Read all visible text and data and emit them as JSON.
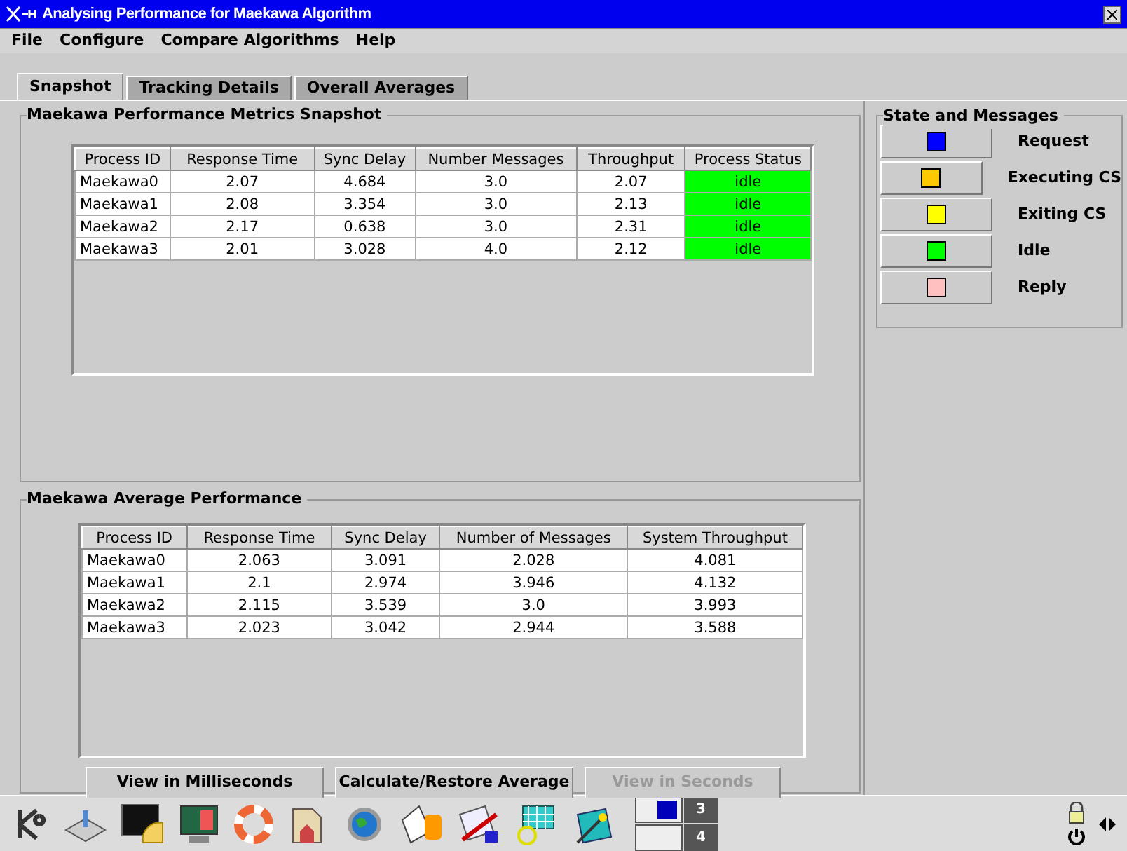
{
  "window": {
    "title": "Analysing Performance for Maekawa Algorithm"
  },
  "menu": [
    "File",
    "Configure",
    "Compare Algorithms",
    "Help"
  ],
  "tabs": [
    {
      "label": "Snapshot",
      "selected": true
    },
    {
      "label": "Tracking Details",
      "selected": false
    },
    {
      "label": "Overall Averages",
      "selected": false
    }
  ],
  "snapshot": {
    "title": "Maekawa Performance Metrics Snapshot",
    "columns": [
      "Process ID",
      "Response Time",
      "Sync Delay",
      "Number Messages",
      "Throughput",
      "Process Status"
    ],
    "rows": [
      {
        "cells": [
          "Maekawa0",
          "2.07",
          "4.684",
          "3.0",
          "2.07"
        ],
        "status": "idle",
        "color": "#00ff00"
      },
      {
        "cells": [
          "Maekawa1",
          "2.08",
          "3.354",
          "3.0",
          "2.13"
        ],
        "status": "idle",
        "color": "#00ff00"
      },
      {
        "cells": [
          "Maekawa2",
          "2.17",
          "0.638",
          "3.0",
          "2.31"
        ],
        "status": "idle",
        "color": "#00ff00"
      },
      {
        "cells": [
          "Maekawa3",
          "2.01",
          "3.028",
          "4.0",
          "2.12"
        ],
        "status": "idle",
        "color": "#00ff00"
      }
    ]
  },
  "averages": {
    "title": "Maekawa Average Performance",
    "columns": [
      "Process ID",
      "Response Time",
      "Sync Delay",
      "Number of Messages",
      "System Throughput"
    ],
    "rows": [
      [
        "Maekawa0",
        "2.063",
        "3.091",
        "2.028",
        "4.081"
      ],
      [
        "Maekawa1",
        "2.1",
        "2.974",
        "3.946",
        "4.132"
      ],
      [
        "Maekawa2",
        "2.115",
        "3.539",
        "3.0",
        "3.993"
      ],
      [
        "Maekawa3",
        "2.023",
        "3.042",
        "2.944",
        "3.588"
      ]
    ]
  },
  "buttons": [
    {
      "label": "View in Milliseconds",
      "disabled": false
    },
    {
      "label": "Calculate/Restore Average",
      "disabled": false
    },
    {
      "label": "View in Seconds",
      "disabled": true
    }
  ],
  "legend": {
    "title": "State and Messages",
    "items": [
      {
        "label": "Request",
        "color": "#0000ff"
      },
      {
        "label": "Executing CS",
        "color": "#ffc800"
      },
      {
        "label": "Exiting CS",
        "color": "#ffff00"
      },
      {
        "label": "Idle",
        "color": "#00ff00"
      },
      {
        "label": "Reply",
        "color": "#ffc0c0"
      }
    ]
  },
  "taskbar": {
    "desktops": [
      "3",
      "4"
    ]
  }
}
